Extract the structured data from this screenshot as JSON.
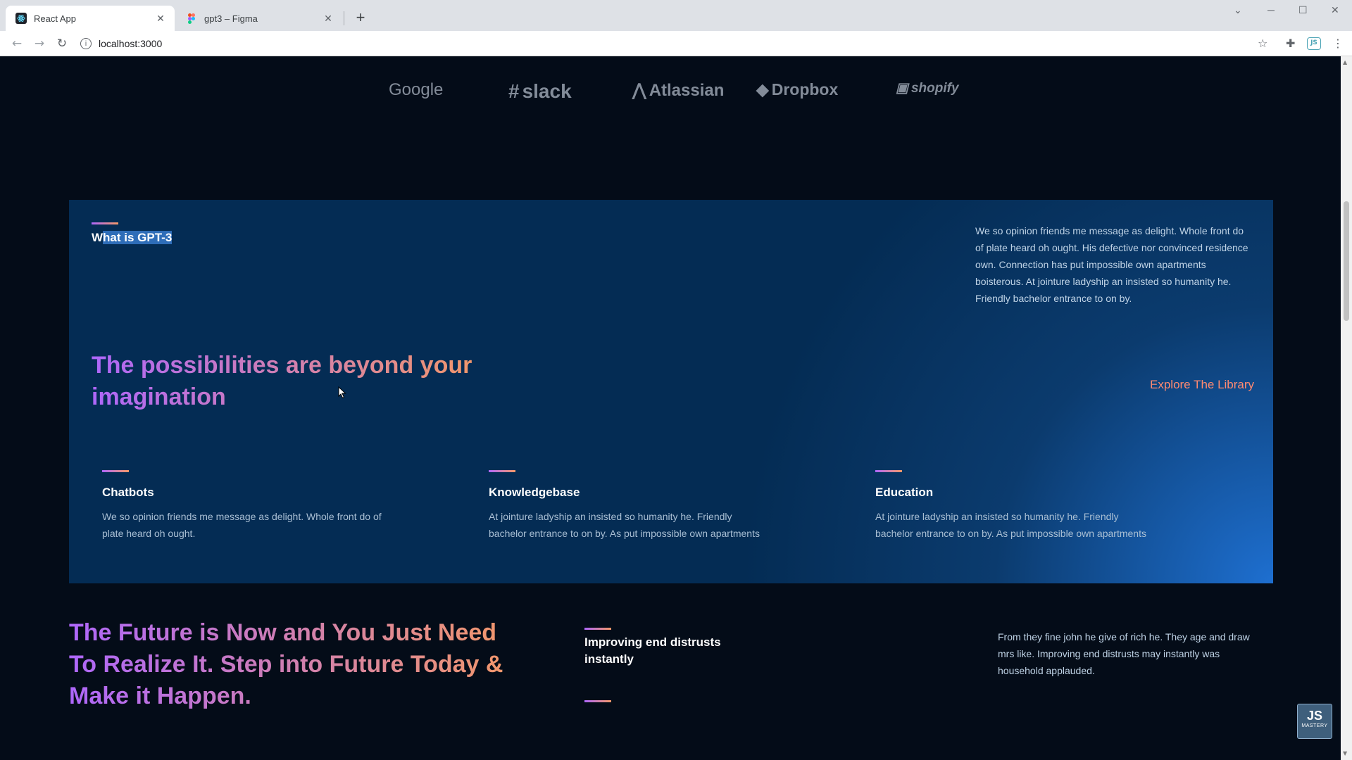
{
  "browser": {
    "tabs": [
      {
        "label": "React App",
        "active": true,
        "icon": "react-icon"
      },
      {
        "label": "gpt3 – Figma",
        "active": false,
        "icon": "figma-icon"
      }
    ],
    "url": "localhost:3000"
  },
  "brands": [
    "Google",
    "slack",
    "Atlassian",
    "Dropbox",
    "shopify"
  ],
  "whatgpt": {
    "label_prefix": "W",
    "label_highlight": "hat is GPT-3",
    "description": "We so opinion friends me message as delight. Whole front do of plate heard oh ought. His defective nor convinced residence own. Connection has put impossible own apartments boisterous. At jointure ladyship an insisted so humanity he. Friendly bachelor entrance to on by.",
    "heading": "The possibilities are beyond your imagination",
    "explore": "Explore The Library",
    "features": [
      {
        "title": "Chatbots",
        "text": "We so opinion friends me message as delight. Whole front do of plate heard oh ought."
      },
      {
        "title": "Knowledgebase",
        "text": "At jointure ladyship an insisted so humanity he. Friendly bachelor entrance to on by. As put impossible own apartments"
      },
      {
        "title": "Education",
        "text": "At jointure ladyship an insisted so humanity he. Friendly bachelor entrance to on by. As put impossible own apartments"
      }
    ]
  },
  "future": {
    "heading": "The Future is Now and You Just Need To Realize It. Step into Future Today & Make it Happen.",
    "feature_title": "Improving end distrusts instantly",
    "feature_text": "From they fine john he give of rich he. They age and draw mrs like. Improving end distrusts may instantly was household applauded."
  },
  "badge": {
    "top": "JS",
    "bottom": "MASTERY"
  },
  "colors": {
    "background": "#040c18",
    "panel": "#042c54",
    "gradient_start": "#ae67fa",
    "gradient_end": "#f49867",
    "explore": "#ff8a71"
  }
}
